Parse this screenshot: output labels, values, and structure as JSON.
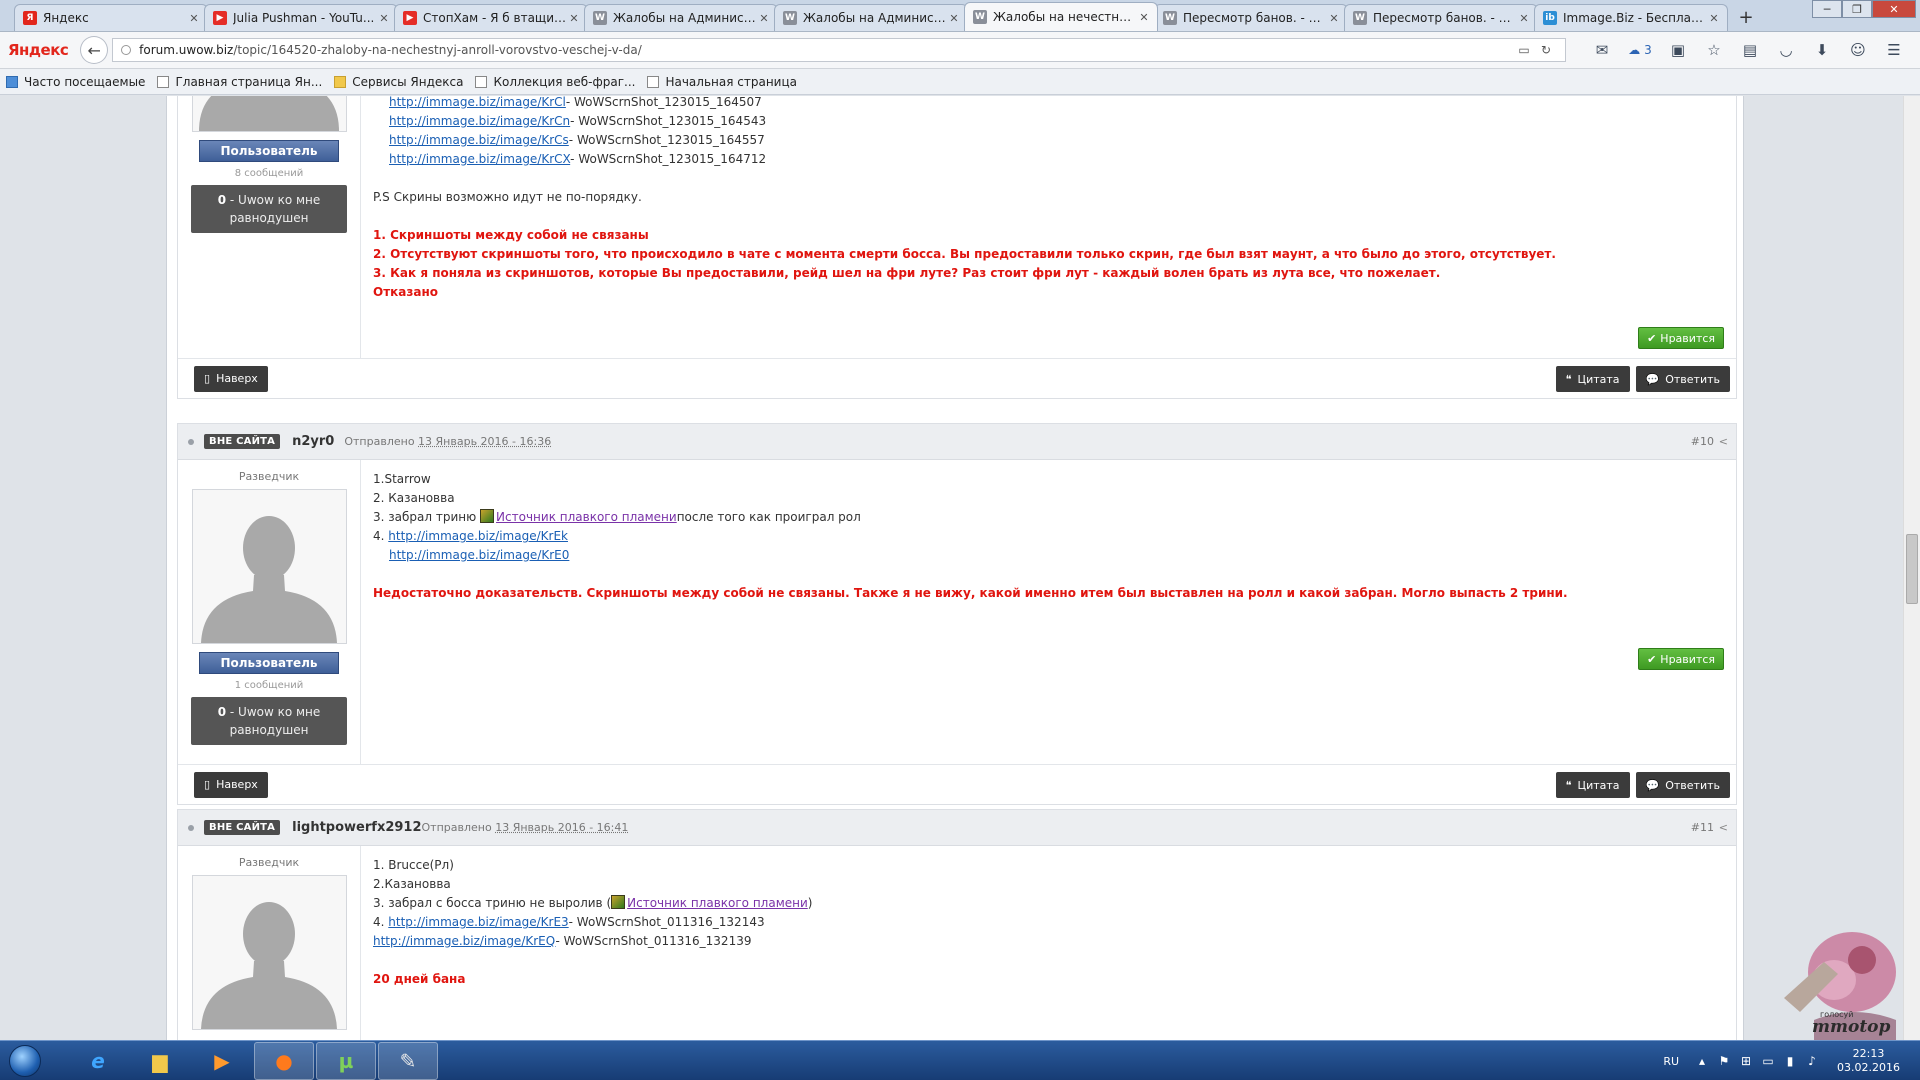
{
  "browser": {
    "tabs": [
      {
        "label": "Яндекс",
        "fav": "Я",
        "color": "#e2261c"
      },
      {
        "label": "Julia Pushman - YouTu...",
        "fav": "▶",
        "color": "#e52d27"
      },
      {
        "label": "СтопХам - Я б втащил...",
        "fav": "▶",
        "color": "#e52d27"
      },
      {
        "label": "Жалобы на Админист...",
        "fav": "W",
        "color": "#8a8f99"
      },
      {
        "label": "Жалобы на Админист...",
        "fav": "W",
        "color": "#8a8f99"
      },
      {
        "label": "Жалобы на нечестны...",
        "fav": "W",
        "color": "#8a8f99"
      },
      {
        "label": "Пересмотр банов. - С...",
        "fav": "W",
        "color": "#8a8f99"
      },
      {
        "label": "Пересмотр банов. - С...",
        "fav": "W",
        "color": "#8a8f99"
      },
      {
        "label": "Immage.Biz - Бесплатн...",
        "fav": "ib",
        "color": "#2d8fd5"
      }
    ],
    "active_tab": 5,
    "logo": "Яндекс",
    "url_host": "forum.uwow.biz",
    "url_path": "/topic/164520-zhaloby-na-nechestnyj-anroll-vorovstvo-veschej-v-da/",
    "cloud_count": "3",
    "bookmarks": [
      "Часто посещаемые",
      "Главная страница Ян...",
      "Сервисы Яндекса",
      "Коллекция веб-фраг...",
      "Начальная страница"
    ]
  },
  "post9": {
    "group": "Пользователь",
    "count": "8 сообщений",
    "rep_num": "0",
    "rep_text": "- Uwow ко мне равнодушен",
    "links": [
      {
        "url": "http://immage.biz/image/KrCl",
        "file": "- WoWScrnShot_123015_164507"
      },
      {
        "url": "http://immage.biz/image/KrCn",
        "file": "- WoWScrnShot_123015_164543"
      },
      {
        "url": "http://immage.biz/image/KrCs",
        "file": "- WoWScrnShot_123015_164557"
      },
      {
        "url": "http://immage.biz/image/KrCX",
        "file": "- WoWScrnShot_123015_164712"
      }
    ],
    "ps": "P.S Скрины возможно идут не по-порядку.",
    "mod": [
      "1. Скриншоты между собой не связаны",
      "2. Отсутствуют скриншоты того, что происходило в чате с момента смерти босса. Вы предоставили только скрин, где был взят маунт, а что было до этого, отсутствует.",
      "3. Как я поняла из скриншотов, которые Вы предоставили, рейд шел на фри луте? Раз стоит фри лут - каждый волен брать из лута все, что пожелает.",
      "Отказано"
    ],
    "like": "Нравится"
  },
  "actions": {
    "top": "Наверх",
    "quote": "Цитата",
    "reply": "Ответить"
  },
  "post10": {
    "status": "ВНЕ САЙТА",
    "author": "n2yr0",
    "posted_prefix": "Отправлено",
    "posted_date": "13 Январь 2016 - 16:36",
    "num": "#10",
    "rank": "Разведчик",
    "group": "Пользователь",
    "count": "1 сообщений",
    "rep_num": "0",
    "rep_text": "- Uwow ко мне равнодушен",
    "line1": "1.Starrow",
    "line2": "2. Казановва",
    "line3_pre": "3. забрал триню",
    "line3_item": "Источник плавкого пламени",
    "line3_post": "после того как проиграл рол",
    "line4_pre": "4.",
    "link1": "http://immage.biz/image/KrEk",
    "link2": "http://immage.biz/image/KrE0",
    "mod": "Недостаточно доказательств. Скриншоты между собой не связаны. Также я не вижу, какой именно итем был выставлен на ролл и какой забран. Могло выпасть 2 трини.",
    "like": "Нравится"
  },
  "post11": {
    "status": "ВНЕ САЙТА",
    "author": "lightpowerfx2912",
    "posted_prefix": "Отправлено",
    "posted_date": "13 Январь 2016 - 16:41",
    "num": "#11",
    "rank": "Разведчик",
    "line1": "1. Brucce(Рл)",
    "line2": "2.Казановва",
    "line3_pre": "3. забрал с босса триню не выролив (",
    "line3_item": "Источник плавкого пламени",
    "line3_post": ")",
    "line4_pre": "4.",
    "link1": "http://immage.biz/image/KrE3",
    "file1": "- WoWScrnShot_011316_132143",
    "link2": "http://immage.biz/image/KrEQ",
    "file2": "- WoWScrnShot_011316_132139",
    "mod": "20 дней бана"
  },
  "badge": {
    "top": "голосуй",
    "name": "mmotop"
  },
  "taskbar": {
    "lang": "RU",
    "time": "22:13",
    "date": "03.02.2016"
  }
}
